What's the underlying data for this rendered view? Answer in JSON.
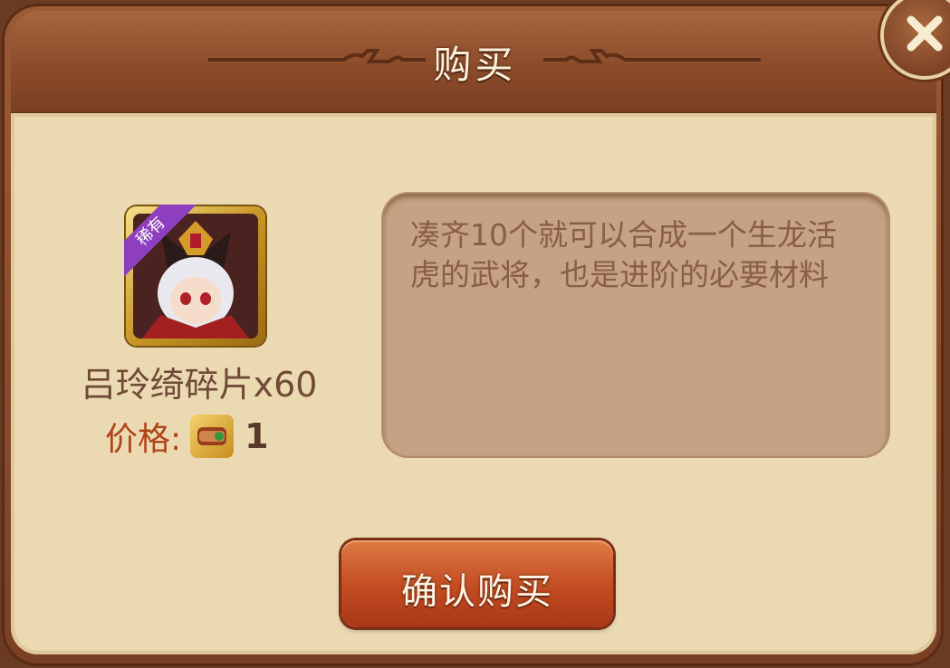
{
  "dialog": {
    "title": "购买",
    "close_icon": "close-icon"
  },
  "item": {
    "rarity": "稀有",
    "name": "吕玲绮碎片x60",
    "portrait_icon": "hero-portrait-icon"
  },
  "price": {
    "label": "价格:",
    "currency_icon": "scroll-currency-icon",
    "value": "1"
  },
  "description": {
    "text": "凑齐10个就可以合成一个生龙活虎的武将，也是进阶的必要材料"
  },
  "actions": {
    "confirm_label": "确认购买"
  },
  "colors": {
    "header": "#8c4c2a",
    "panel": "#ebd9b2",
    "desc_box": "#c4a283",
    "price_label": "#b04419",
    "confirm_button": "#c24b22",
    "rare_ribbon": "#8d3fc0"
  }
}
